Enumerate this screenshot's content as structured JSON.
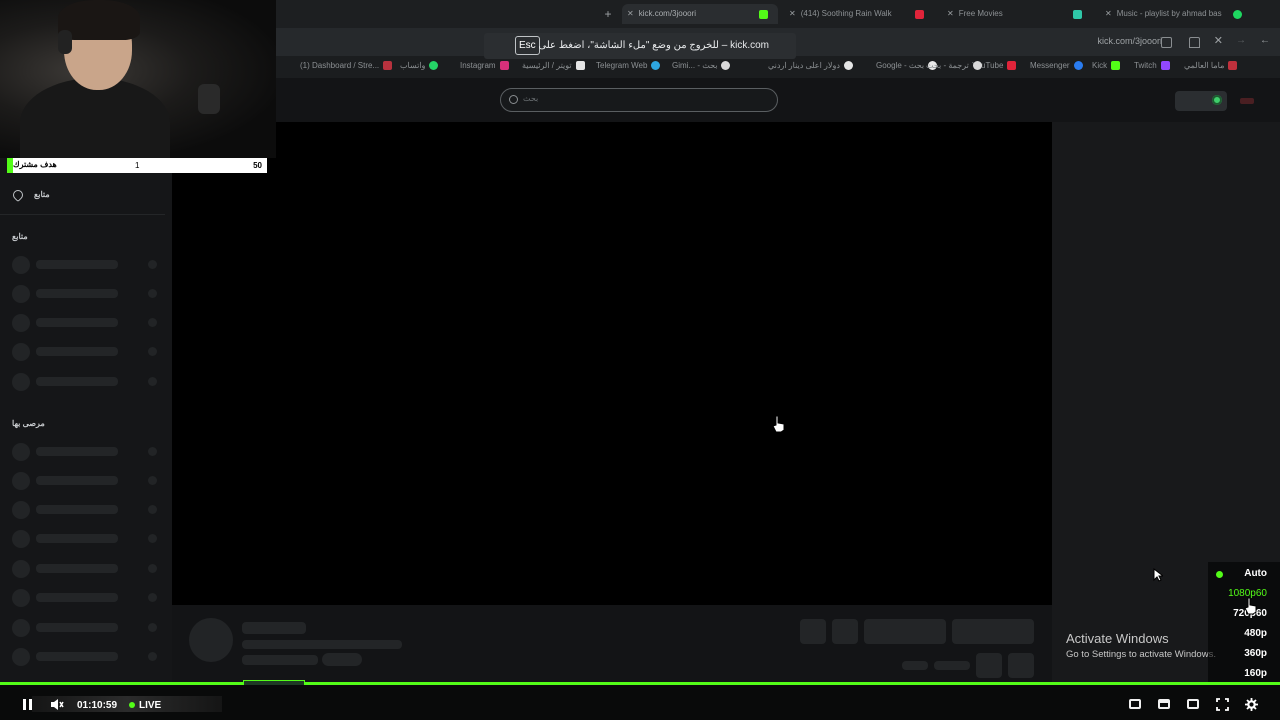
{
  "browser": {
    "tabs": [
      {
        "label": "kick.com/3jooori",
        "active": true
      },
      {
        "label": "(414) Soothing Rain Walk"
      },
      {
        "label": "Free Movies"
      },
      {
        "label": "Music - playlist by ahmad bas"
      }
    ],
    "address": "kick.com/3jooori",
    "bookmarks": [
      "(1) Dashboard / Stre...",
      "واتساب",
      "Instagram",
      "تويتر / الرئيسية",
      "Telegram Web",
      "Gimi... - بحث",
      "Google - بحث",
      "YouTube",
      "Messenger",
      "Kick",
      "Twitch",
      "ماما العالمي",
      "دولار اعلى دينار اردني",
      "ترجمة - بحث"
    ],
    "fullscreen_notice": {
      "text": "kick.com – للخروج من وضع \"ملء الشاشة\"، اضغط على",
      "key": "Esc"
    }
  },
  "site": {
    "search_placeholder": "بحث",
    "sidebar": {
      "following_label": "متابع",
      "section_following": "متابع",
      "section_recommended": "مرصى بها"
    }
  },
  "overlay": {
    "sub_goal": {
      "label": "هدف مشترك",
      "current": "1",
      "target": "50",
      "progress": 0.02
    }
  },
  "player": {
    "time": "01:10:59",
    "live_label": "LIVE",
    "quality_options": [
      {
        "label": "Auto",
        "selected": false
      },
      {
        "label": "1080p60",
        "selected": true
      },
      {
        "label": "720p60",
        "selected": false
      },
      {
        "label": "480p",
        "selected": false
      },
      {
        "label": "360p",
        "selected": false
      },
      {
        "label": "160p",
        "selected": false
      }
    ],
    "accent_color": "#53fc18"
  },
  "os": {
    "activate_title": "Activate Windows",
    "activate_sub": "Go to Settings to activate Windows."
  }
}
